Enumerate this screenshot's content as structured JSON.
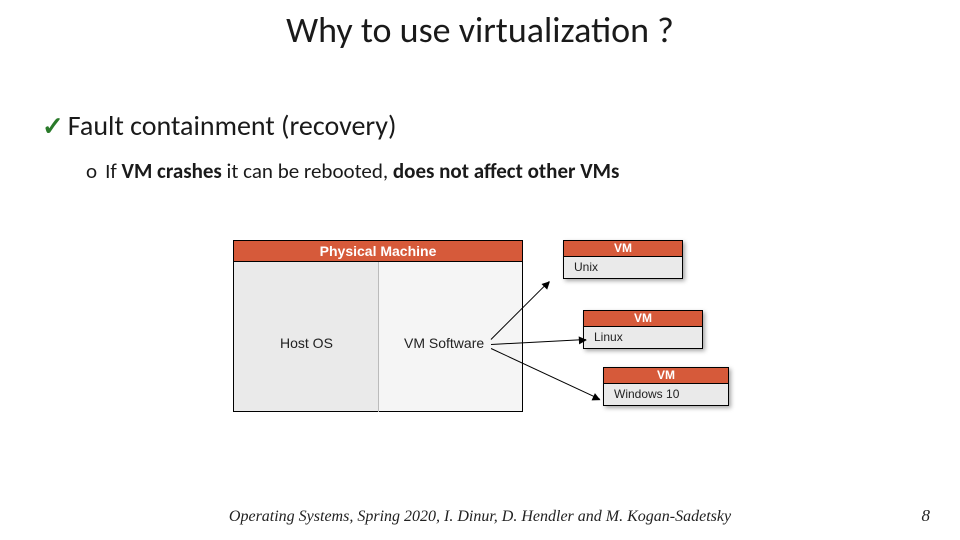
{
  "title": "Why to use virtualization ?",
  "bullet1": "Fault containment (recovery)",
  "bullet2": {
    "prefix": "If ",
    "bold1": "VM crashes",
    "mid": " it can be rebooted, ",
    "bold2": "does not affect other VMs"
  },
  "diagram": {
    "pm_header": "Physical Machine",
    "host_os": "Host OS",
    "vm_software": "VM Software",
    "vm_label": "VM",
    "vms": {
      "unix": "Unix",
      "linux": "Linux",
      "windows": "Windows 10"
    }
  },
  "footer": "Operating Systems, Spring 2020, I. Dinur, D. Hendler and M. Kogan-Sadetsky",
  "page": "8"
}
